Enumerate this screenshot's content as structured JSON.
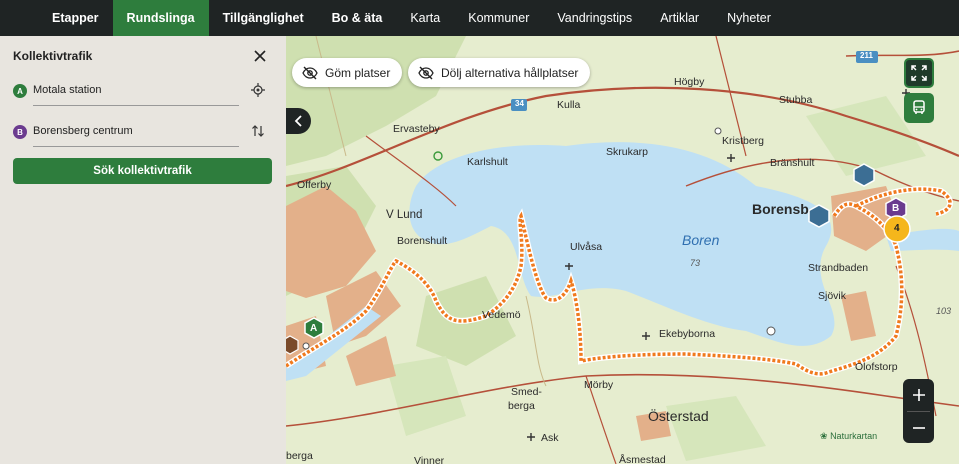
{
  "nav": {
    "items": [
      {
        "label": "Etapper",
        "state": "bold"
      },
      {
        "label": "Rundslinga",
        "state": "active"
      },
      {
        "label": "Tillgänglighet",
        "state": "bold"
      },
      {
        "label": "Bo & äta",
        "state": "bold"
      },
      {
        "label": "Karta",
        "state": "normal"
      },
      {
        "label": "Kommuner",
        "state": "normal"
      },
      {
        "label": "Vandringstips",
        "state": "normal"
      },
      {
        "label": "Artiklar",
        "state": "normal"
      },
      {
        "label": "Nyheter",
        "state": "normal"
      }
    ]
  },
  "panel": {
    "title": "Kollektivtrafik",
    "from": {
      "badge": "A",
      "value": "Motala station"
    },
    "to": {
      "badge": "B",
      "value": "Borensberg centrum"
    },
    "search_label": "Sök kollektivtrafik"
  },
  "map": {
    "hide_places_label": "Göm platser",
    "hide_stops_label": "Dölj alternativa hållplatser",
    "credit": "Naturkartan",
    "labels": {
      "hogby": "Högby",
      "stubba": "Stubba",
      "kulla": "Kulla",
      "ervasteby": "Ervasteby",
      "kristberg": "Kristberg",
      "karlshult": "Karlshult",
      "skrukarp": "Skrukarp",
      "branshult": "Bränshult",
      "offerby": "Offerby",
      "borensberg": "Borensb",
      "vlund": "V Lund",
      "borenshult": "Borenshult",
      "ulvasa": "Ulvåsa",
      "boren": "Boren",
      "depth": "73",
      "strandbaden": "Strandbaden",
      "sjovik": "Sjövik",
      "vedemo": "Vedemö",
      "ekebyborna": "Ekebyborna",
      "olofstorp": "Olofstorp",
      "smedberga1": "Smed-",
      "smedberga2": "berga",
      "morby": "Mörby",
      "osterstad": "Österstad",
      "ask": "Ask",
      "road34": "34",
      "road211": "211",
      "num103": "103",
      "vinner": "Vinner",
      "asmestad": "Åsmestad",
      "berga": "berga",
      "marker_a": "A",
      "marker_b": "B",
      "marker_4": "4"
    }
  },
  "colors": {
    "nav_bg": "#1f2424",
    "accent_green": "#2e7d3d",
    "lake": "#bfe0f4",
    "route": "#f07a1e",
    "urban": "#e0a880"
  },
  "icons": {
    "close": "close-icon",
    "locate": "crosshair-icon",
    "swap": "swap-icon",
    "eye_off": "eye-off-icon",
    "fullscreen": "expand-icon",
    "bus": "bus-icon",
    "collapse": "chevron-left-icon"
  }
}
